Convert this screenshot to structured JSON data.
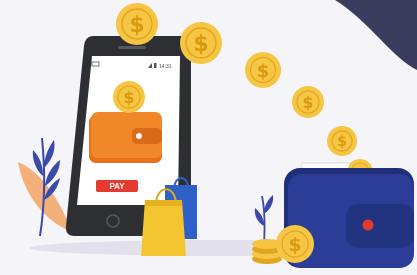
{
  "phone": {
    "status_time": "14:31",
    "pay_button_label": "PAY"
  },
  "coins": {
    "symbol": "$"
  },
  "icons": {
    "phone": "smartphone-icon",
    "wallet_on_screen": "wallet-icon",
    "pay_button": "pay-button",
    "shopping_bags": "shopping-bag-icon",
    "coin": "dollar-coin-icon",
    "wallet": "wallet-icon"
  },
  "colors": {
    "background": "#f5f4f8",
    "dark_corner": "#3a3d5e",
    "phone_body": "#2d2f33",
    "screen": "#ffffff",
    "wallet_orange": "#f0882a",
    "pay_red": "#e53a2e",
    "coin_gold": "#f6c543",
    "wallet_blue": "#2b3d96",
    "bag_yellow": "#f3c531",
    "bag_blue": "#2f60c7",
    "leaf_orange": "#f3b07a",
    "leaf_blue": "#3b4aa8"
  }
}
